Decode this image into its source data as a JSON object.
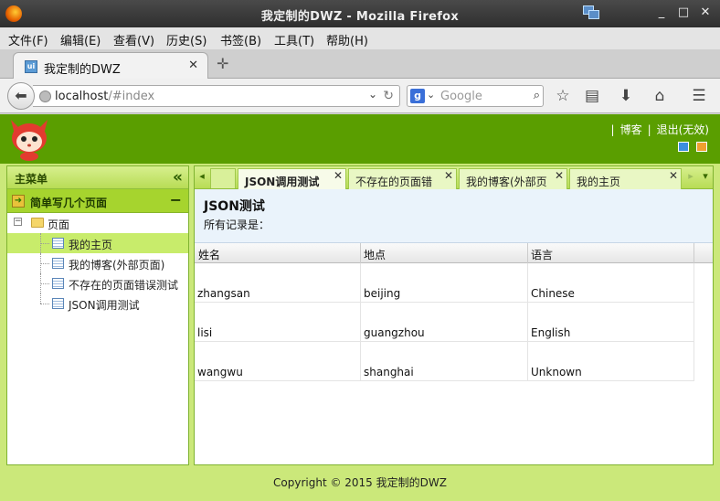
{
  "window": {
    "title": "我定制的DWZ - Mozilla Firefox",
    "controls": {
      "minimize": "_",
      "maximize": "□",
      "close": "✕"
    }
  },
  "menu": [
    "文件(F)",
    "编辑(E)",
    "查看(V)",
    "历史(S)",
    "书签(B)",
    "工具(T)",
    "帮助(H)"
  ],
  "browser_tab": {
    "label": "我定制的DWZ",
    "favicon": "ui",
    "close": "✕",
    "new_tab": "✛"
  },
  "navbar": {
    "url_host": "localhost",
    "url_path": "/#index",
    "search_placeholder": "Google",
    "search_engine_icon": "g"
  },
  "header": {
    "links": [
      "博客",
      "退出(无效)"
    ],
    "theme_colors": [
      "#3b8ee0",
      "#f0a030"
    ]
  },
  "sidebar": {
    "title": "主菜单",
    "collapse": "«",
    "accordion_title": "简单写几个页面",
    "accordion_toggle": "−",
    "tree_root": "页面",
    "tree_toggle": "−",
    "items": [
      "我的主页",
      "我的博客(外部页面)",
      "不存在的页面错误测试",
      "JSON调用测试"
    ],
    "selected_index": 0
  },
  "content": {
    "tabs": [
      "JSON调用测试",
      "不存在的页面错",
      "我的博客(外部页",
      "我的主页"
    ],
    "tab_close": "✕",
    "active_tab": 0,
    "nav_left": "◂",
    "nav_right": "▸",
    "nav_more": "▾",
    "panel_title": "JSON测试",
    "panel_subtitle": "所有记录是：",
    "table": {
      "headers": [
        "姓名",
        "地点",
        "语言"
      ],
      "rows": [
        [
          "zhangsan",
          "beijing",
          "Chinese"
        ],
        [
          "lisi",
          "guangzhou",
          "English"
        ],
        [
          "wangwu",
          "shanghai",
          "Unknown"
        ]
      ]
    }
  },
  "footer": "Copyright © 2015 我定制的DWZ"
}
